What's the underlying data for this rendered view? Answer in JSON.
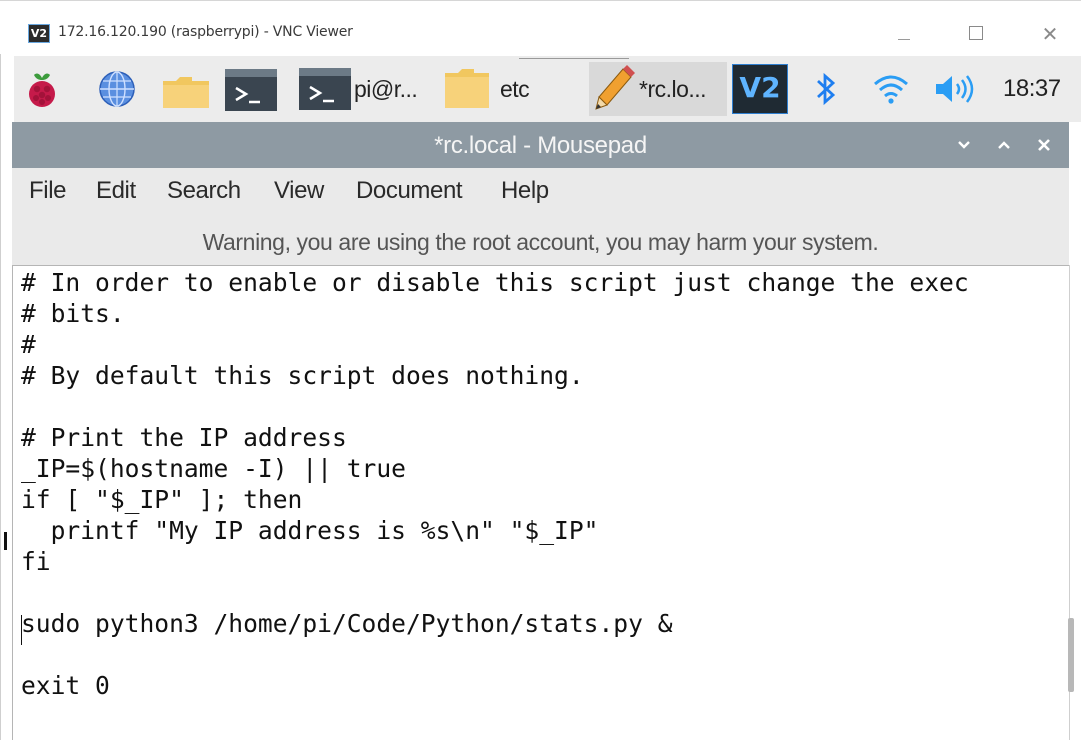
{
  "vnc_window": {
    "logo_text": "V2",
    "title": "172.16.120.190 (raspberrypi) - VNC Viewer"
  },
  "taskbar": {
    "terminal_task_label": "pi@r...",
    "folder_task_label": "etc",
    "editor_task_label": "*rc.lo...",
    "vnc_tray_text": "V2",
    "clock": "18:37"
  },
  "editor_window": {
    "title": "*rc.local - Mousepad"
  },
  "menu": {
    "items": [
      "File",
      "Edit",
      "Search",
      "View",
      "Document",
      "Help"
    ]
  },
  "warning": "Warning, you are using the root account, you may harm your system.",
  "code": {
    "lines": [
      "# In order to enable or disable this script just change the exec",
      "# bits.",
      "#",
      "# By default this script does nothing.",
      "",
      "# Print the IP address",
      "_IP=$(hostname -I) || true",
      "if [ \"$_IP\" ]; then",
      "  printf \"My IP address is %s\\n\" \"$_IP\"",
      "fi",
      "",
      "sudo python3 /home/pi/Code/Python/stats.py &",
      "",
      "exit 0"
    ]
  },
  "colors": {
    "editor_titlebar": "#8e9aa3",
    "panel_background": "#ececec",
    "menu_background": "#eaeaea",
    "vnc_accent": "#2f7fd0"
  },
  "icons": {
    "panel": [
      "raspberry-pi-icon",
      "globe-icon",
      "folder-icon",
      "terminal-icon"
    ],
    "tray": [
      "vnc-icon",
      "bluetooth-icon",
      "wifi-icon",
      "volume-icon"
    ]
  }
}
